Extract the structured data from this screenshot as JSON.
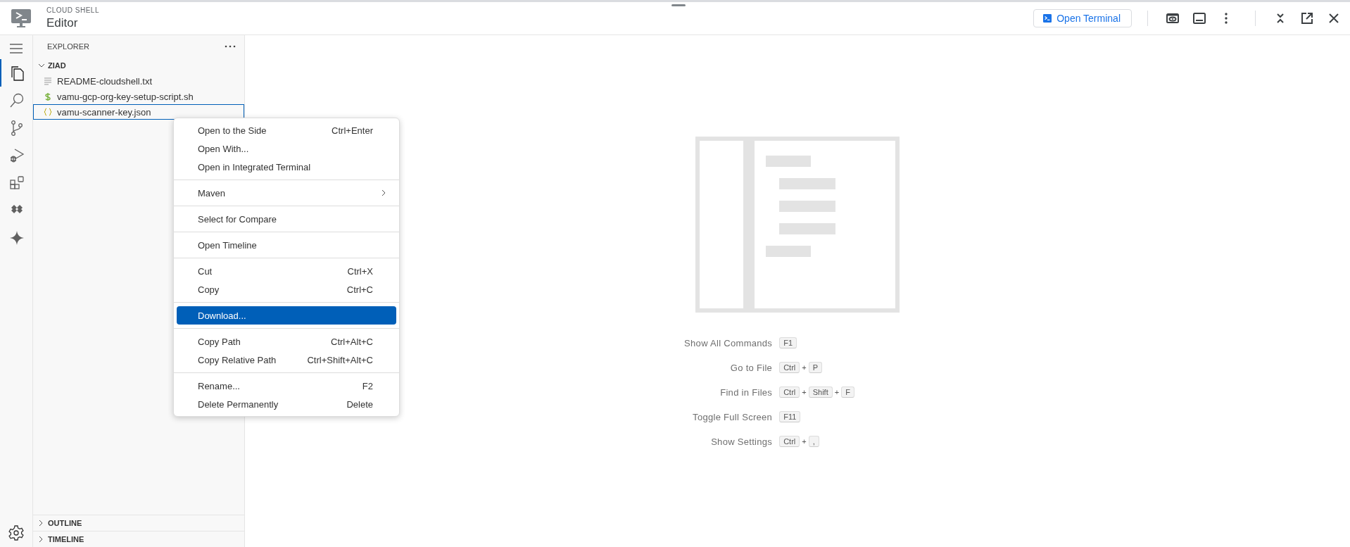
{
  "header": {
    "product": "CLOUD SHELL",
    "title": "Editor",
    "open_terminal": "Open Terminal"
  },
  "activity_bar": [
    {
      "kind": "explorer",
      "selected": true
    },
    {
      "kind": "search",
      "selected": false
    },
    {
      "kind": "source-control",
      "selected": false
    },
    {
      "kind": "run-debug",
      "selected": false
    },
    {
      "kind": "extensions",
      "selected": false
    },
    {
      "kind": "diamonds",
      "selected": false
    },
    {
      "kind": "sparkle",
      "selected": false
    }
  ],
  "sidebar": {
    "title": "EXPLORER",
    "folder": {
      "name": "ZIAD",
      "expanded": true,
      "files": [
        {
          "name": "README-cloudshell.txt",
          "kind": "text",
          "selected": false
        },
        {
          "name": "vamu-gcp-org-key-setup-script.sh",
          "kind": "shell",
          "selected": false
        },
        {
          "name": "vamu-scanner-key.json",
          "kind": "json",
          "selected": true
        }
      ]
    },
    "sections": [
      {
        "label": "OUTLINE",
        "expanded": false
      },
      {
        "label": "TIMELINE",
        "expanded": false
      }
    ]
  },
  "context_menu": [
    [
      {
        "label": "Open to the Side",
        "shortcut": "Ctrl+Enter",
        "selected": false
      },
      {
        "label": "Open With...",
        "selected": false
      },
      {
        "label": "Open in Integrated Terminal",
        "selected": false
      }
    ],
    [
      {
        "label": "Maven",
        "submenu": true,
        "selected": false
      }
    ],
    [
      {
        "label": "Select for Compare",
        "selected": false
      }
    ],
    [
      {
        "label": "Open Timeline",
        "selected": false
      }
    ],
    [
      {
        "label": "Cut",
        "shortcut": "Ctrl+X",
        "selected": false
      },
      {
        "label": "Copy",
        "shortcut": "Ctrl+C",
        "selected": false
      }
    ],
    [
      {
        "label": "Download...",
        "selected": true
      }
    ],
    [
      {
        "label": "Copy Path",
        "shortcut": "Ctrl+Alt+C",
        "selected": false
      },
      {
        "label": "Copy Relative Path",
        "shortcut": "Ctrl+Shift+Alt+C",
        "selected": false
      }
    ],
    [
      {
        "label": "Rename...",
        "shortcut": "F2",
        "selected": false
      },
      {
        "label": "Delete Permanently",
        "shortcut": "Delete",
        "selected": false
      }
    ]
  ],
  "hints": [
    {
      "label": "Show All Commands",
      "keys": [
        {
          "kind": "key",
          "text": "F1"
        }
      ]
    },
    {
      "label": "Go to File",
      "keys": [
        {
          "kind": "key",
          "text": "Ctrl"
        },
        {
          "kind": "plus",
          "text": "+"
        },
        {
          "kind": "key",
          "text": "P"
        }
      ]
    },
    {
      "label": "Find in Files",
      "keys": [
        {
          "kind": "key",
          "text": "Ctrl"
        },
        {
          "kind": "plus",
          "text": "+"
        },
        {
          "kind": "key",
          "text": "Shift"
        },
        {
          "kind": "plus",
          "text": "+"
        },
        {
          "kind": "key",
          "text": "F"
        }
      ]
    },
    {
      "label": "Toggle Full Screen",
      "keys": [
        {
          "kind": "key",
          "text": "F11"
        }
      ]
    },
    {
      "label": "Show Settings",
      "keys": [
        {
          "kind": "key",
          "text": "Ctrl"
        },
        {
          "kind": "plus",
          "text": "+"
        },
        {
          "kind": "key",
          "text": ","
        }
      ]
    }
  ]
}
